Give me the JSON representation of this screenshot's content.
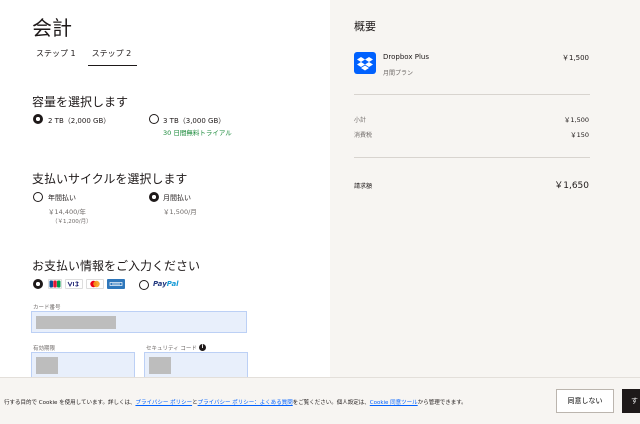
{
  "page": {
    "title": "会計",
    "steps": [
      "ステップ 1",
      "ステップ 2"
    ]
  },
  "capacity": {
    "title": "容量を選択します",
    "options": [
      {
        "label": "2 TB（2,000 GB）",
        "selected": true
      },
      {
        "label": "3 TB（3,000 GB）",
        "selected": false,
        "note": "30 日間無料トライアル"
      }
    ]
  },
  "billing": {
    "title": "支払いサイクルを選択します",
    "options": [
      {
        "label": "年間払い",
        "price": "￥14,400/年",
        "sub": "（￥1,200/月）",
        "selected": false
      },
      {
        "label": "月間払い",
        "price": "￥1,500/月",
        "selected": true
      }
    ]
  },
  "payment": {
    "title": "お支払い情報をご入力ください",
    "card_brands": [
      "JCB",
      "VISA",
      "Mastercard",
      "AMEX"
    ],
    "paypal_label": {
      "pay": "Pay",
      "pal": "Pal"
    },
    "card_number_label": "カード番号",
    "expiry_label": "有効期限",
    "security_code_label": "セキュリティ コード",
    "info_icon": "info-icon"
  },
  "summary": {
    "title": "概要",
    "product_name": "Dropbox Plus",
    "product_plan": "月間プラン",
    "product_price": "￥1,500",
    "subtotal_label": "小計",
    "subtotal_value": "￥1,500",
    "tax_label": "消費税",
    "tax_value": "￥150",
    "total_label": "請求額",
    "total_value": "￥1,650"
  },
  "cookie": {
    "text_1": "行する目的で Cookie を使用しています。詳しくは、",
    "link_1": "プライバシー ポリシー",
    "text_2": "と",
    "link_2": "プライバシー ポリシー：よくある質問",
    "text_3": "をご覧ください。個人設定は、",
    "link_3": "Cookie 同意ツール",
    "text_4": "から管理できます。",
    "decline_label": "同意しない",
    "accept_label": "す"
  },
  "colors": {
    "accent": "#0061fe",
    "text": "#1e1919",
    "trial_green": "#1a8a3a",
    "panel": "#f7f5f2"
  }
}
